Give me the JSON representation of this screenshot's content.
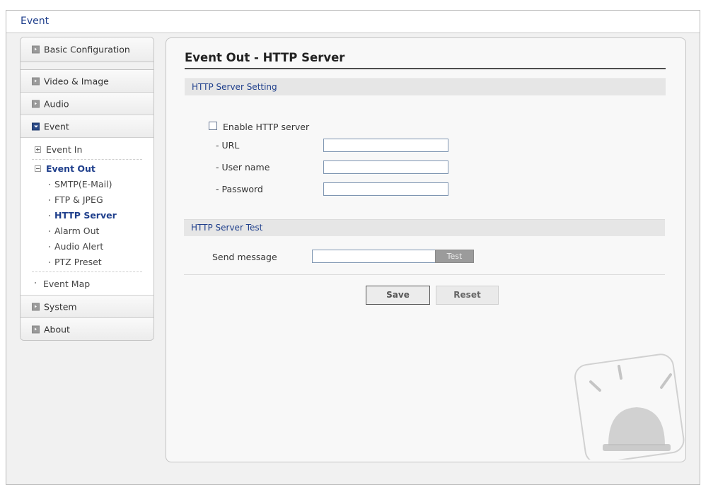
{
  "window": {
    "title": "Event"
  },
  "sidebar": {
    "basic_configuration": "Basic Configuration",
    "video_image": "Video & Image",
    "audio": "Audio",
    "event": "Event",
    "event_in": "Event In",
    "event_out": "Event Out",
    "event_out_items": [
      "SMTP(E-Mail)",
      "FTP & JPEG",
      "HTTP Server",
      "Alarm Out",
      "Audio Alert",
      "PTZ Preset"
    ],
    "event_map": "Event Map",
    "system": "System",
    "about": "About"
  },
  "main": {
    "title": "Event Out - HTTP Server",
    "setting_section": "HTTP Server Setting",
    "enable_label": "Enable HTTP server",
    "enable_checked": false,
    "url_label": "- URL",
    "url_value": "",
    "username_label": "- User name",
    "username_value": "",
    "password_label": "- Password",
    "password_value": "",
    "test_section": "HTTP Server Test",
    "send_message_label": "Send message",
    "send_message_value": "",
    "test_button": "Test",
    "save_button": "Save",
    "reset_button": "Reset"
  },
  "colors": {
    "accent": "#1f3f8c",
    "active_icon": "#2b4a87",
    "section_bg": "#e6e6e6"
  }
}
